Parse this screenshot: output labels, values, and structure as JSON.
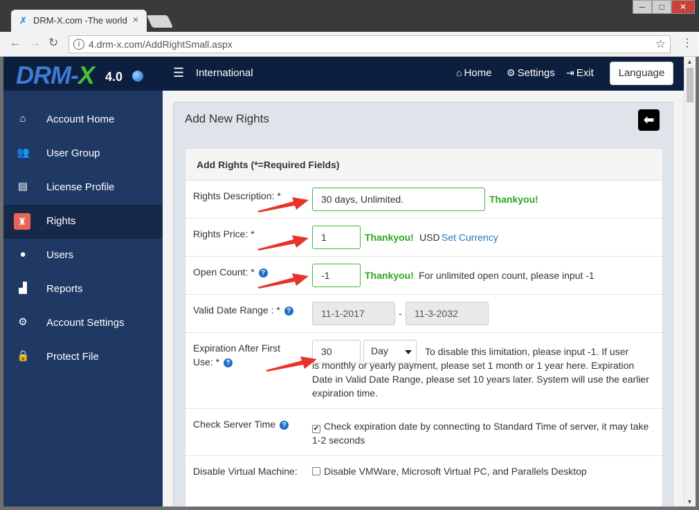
{
  "browser": {
    "tab_title": "DRM-X.com -The world",
    "tab_close": "×",
    "url": "4.drm-x.com/AddRightSmall.aspx",
    "minimize": "─",
    "maximize": "□",
    "close": "✕"
  },
  "header": {
    "logo_text": "DRM-",
    "logo_x": "X",
    "logo_version": "4.0",
    "menu_label": "International",
    "nav": [
      {
        "label": "Home",
        "icon": "home-icon"
      },
      {
        "label": "Settings",
        "icon": "gear-icon"
      },
      {
        "label": "Exit",
        "icon": "exit-icon"
      }
    ],
    "language_button": "Language"
  },
  "sidebar": {
    "items": [
      {
        "label": "Account Home",
        "icon": "home-icon"
      },
      {
        "label": "User Group",
        "icon": "user-group-icon"
      },
      {
        "label": "License Profile",
        "icon": "file-icon"
      },
      {
        "label": "Rights",
        "icon": "rights-icon",
        "active": true
      },
      {
        "label": "Users",
        "icon": "user-icon"
      },
      {
        "label": "Reports",
        "icon": "chart-icon"
      },
      {
        "label": "Account Settings",
        "icon": "gear-icon"
      },
      {
        "label": "Protect File",
        "icon": "lock-icon"
      }
    ]
  },
  "main": {
    "title": "Add New Rights",
    "panel_title": "Add Rights (*=Required Fields)",
    "rights_description": {
      "label": "Rights Description: *",
      "value": "30 days, Unlimited.",
      "status": "Thankyou!"
    },
    "rights_price": {
      "label": "Rights Price: *",
      "value": "1",
      "status": "Thankyou!",
      "currency": "USD",
      "currency_link": "Set Currency"
    },
    "open_count": {
      "label": "Open Count: *",
      "value": "-1",
      "status": "Thankyou!",
      "hint": "For unlimited open count, please input -1"
    },
    "valid_date": {
      "label": "Valid Date Range : *",
      "from": "11-1-2017",
      "separator": "-",
      "to": "11-3-2032"
    },
    "expiration": {
      "label": "Expiration After First Use: *",
      "value": "30",
      "unit": "Day",
      "hint_line1": "To disable this limitation, please input -1. If user",
      "hint_rest": "is monthly or yearly payment, please set 1 month or 1 year here. Expiration Date in Valid Date Range, please set 10 years later. System will use the earlier expiration time."
    },
    "check_server_time": {
      "label": "Check Server Time",
      "checked": true,
      "text": "Check expiration date by connecting to Standard Time of server, it may take 1-2 seconds"
    },
    "disable_vm": {
      "label": "Disable Virtual Machine:",
      "checked": false,
      "text": "Disable VMWare, Microsoft Virtual PC, and Parallels Desktop"
    }
  },
  "colors": {
    "navbar": "#0d1f3e",
    "sidebar": "#1f3864",
    "success": "#2ea61f",
    "active_icon": "#e76457",
    "arrow": "#e8332a"
  }
}
